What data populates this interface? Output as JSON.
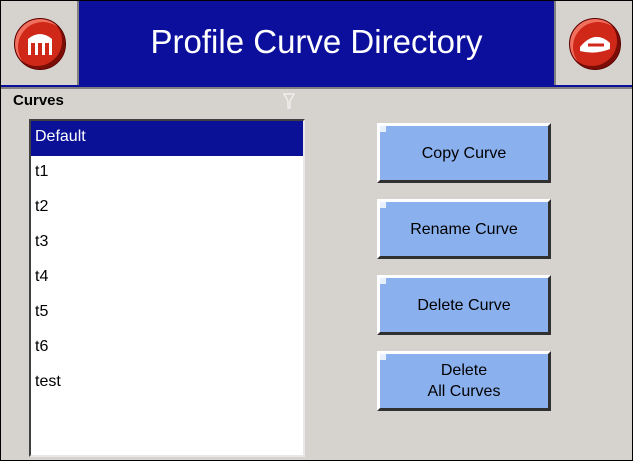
{
  "header": {
    "title": "Profile Curve Directory",
    "left_icon": "building-icon",
    "right_icon": "exit-icon"
  },
  "curves": {
    "label": "Curves",
    "items": [
      "Default",
      "t1",
      "t2",
      "t3",
      "t4",
      "t5",
      "t6",
      "test"
    ],
    "selected": "Default"
  },
  "actions": {
    "copy": "Copy Curve",
    "rename": "Rename Curve",
    "delete": "Delete Curve",
    "delete_all": "Delete\nAll Curves"
  },
  "colors": {
    "title_bar": "#0b0f9c",
    "button": "#8ab0ee",
    "selection": "#0a1196",
    "icon_red": "#d02818"
  }
}
